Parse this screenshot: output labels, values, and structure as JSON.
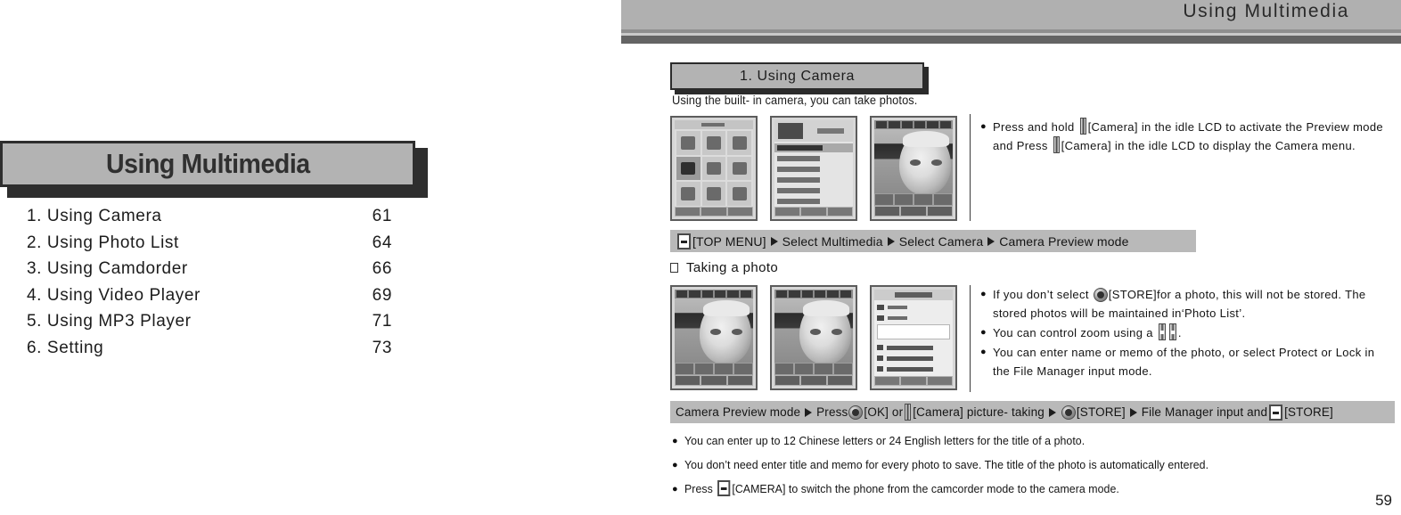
{
  "left_page": {
    "banner_title": "Using Multimedia",
    "toc": [
      {
        "label": "1. Using Camera",
        "page": "61"
      },
      {
        "label": "2. Using Photo List",
        "page": "64"
      },
      {
        "label": "3. Using Camdorder",
        "page": "66"
      },
      {
        "label": "4. Using Video Player",
        "page": "69"
      },
      {
        "label": "5. Using MP3 Player",
        "page": "71"
      },
      {
        "label": "6. Setting",
        "page": "73"
      }
    ]
  },
  "right_page": {
    "header_title": "Using Multimedia",
    "section_title": "1. Using Camera",
    "intro": "Using the built- in camera, you can take photos.",
    "subsection_title": "Taking a photo",
    "page_number": "59",
    "bullets_1": [
      {
        "parts": [
          {
            "t": "text",
            "v": "Press and hold "
          },
          {
            "t": "icon",
            "v": "side-key-icon"
          },
          {
            "t": "text",
            "v": "[Camera] in the idle LCD to activate the Preview mode and Press "
          },
          {
            "t": "icon",
            "v": "side-key-icon"
          },
          {
            "t": "text",
            "v": "[Camera] in the idle LCD to display the Camera menu."
          }
        ]
      }
    ],
    "bullets_2": [
      {
        "parts": [
          {
            "t": "text",
            "v": "If you don’t select "
          },
          {
            "t": "icon",
            "v": "round-ok-key-icon"
          },
          {
            "t": "text",
            "v": "[STORE]for a photo, this will not be stored. The stored photos will be maintained in‘Photo List’."
          }
        ]
      },
      {
        "parts": [
          {
            "t": "text",
            "v": "You can control zoom using a "
          },
          {
            "t": "icon",
            "v": "zoom-up-key-icon"
          },
          {
            "t": "icon",
            "v": "zoom-down-key-icon"
          },
          {
            "t": "text",
            "v": "."
          }
        ]
      },
      {
        "parts": [
          {
            "t": "text",
            "v": "You can enter name or memo of the photo, or select Protect or Lock in the File Manager input mode."
          }
        ]
      }
    ],
    "bullets_3": [
      {
        "parts": [
          {
            "t": "text",
            "v": "You can enter up to 12 Chinese letters or 24 English letters for the title of a photo."
          }
        ]
      },
      {
        "parts": [
          {
            "t": "text",
            "v": "You don’t need enter title and memo for every photo to save. The title of the photo is automatically entered."
          }
        ]
      },
      {
        "parts": [
          {
            "t": "text",
            "v": "Press "
          },
          {
            "t": "icon",
            "v": "rect-camera-key-icon"
          },
          {
            "t": "text",
            "v": "[CAMERA] to switch the phone from the camcorder mode to the camera mode."
          }
        ]
      }
    ],
    "breadcrumb_1": [
      {
        "t": "icon",
        "v": "rect-menu-key-icon"
      },
      {
        "t": "text",
        "v": "[TOP MENU]"
      },
      {
        "t": "arrow"
      },
      {
        "t": "text",
        "v": "Select Multimedia"
      },
      {
        "t": "arrow"
      },
      {
        "t": "text",
        "v": "Select Camera"
      },
      {
        "t": "arrow"
      },
      {
        "t": "text",
        "v": "Camera Preview mode"
      }
    ],
    "breadcrumb_2": [
      {
        "t": "text",
        "v": "Camera Preview mode"
      },
      {
        "t": "arrow"
      },
      {
        "t": "text",
        "v": "Press"
      },
      {
        "t": "icon",
        "v": "round-ok-key-icon"
      },
      {
        "t": "text",
        "v": "[OK] or"
      },
      {
        "t": "icon",
        "v": "side-key-icon"
      },
      {
        "t": "text",
        "v": "[Camera] picture- taking"
      },
      {
        "t": "arrow"
      },
      {
        "t": "icon",
        "v": "round-ok-key-icon"
      },
      {
        "t": "text",
        "v": "[STORE]"
      },
      {
        "t": "arrow"
      },
      {
        "t": "text",
        "v": "File Manager input and"
      },
      {
        "t": "icon",
        "v": "rect-menu-key-icon"
      },
      {
        "t": "text",
        "v": "[STORE]"
      }
    ],
    "screenshots_row_1": [
      {
        "kind": "menu-grid-screen"
      },
      {
        "kind": "camera-menu-list-screen"
      },
      {
        "kind": "camera-preview-screen"
      }
    ],
    "screenshots_row_2": [
      {
        "kind": "camera-preview-screen"
      },
      {
        "kind": "captured-photo-screen"
      },
      {
        "kind": "file-manager-input-screen"
      }
    ]
  },
  "colors": {
    "banner_fill": "#b3b3b3",
    "banner_border": "#2e2e2e",
    "header_band": "#b0b0b0",
    "header_band_dark": "#646464",
    "crumb_bar": "#b9b9b9",
    "text": "#141414"
  }
}
